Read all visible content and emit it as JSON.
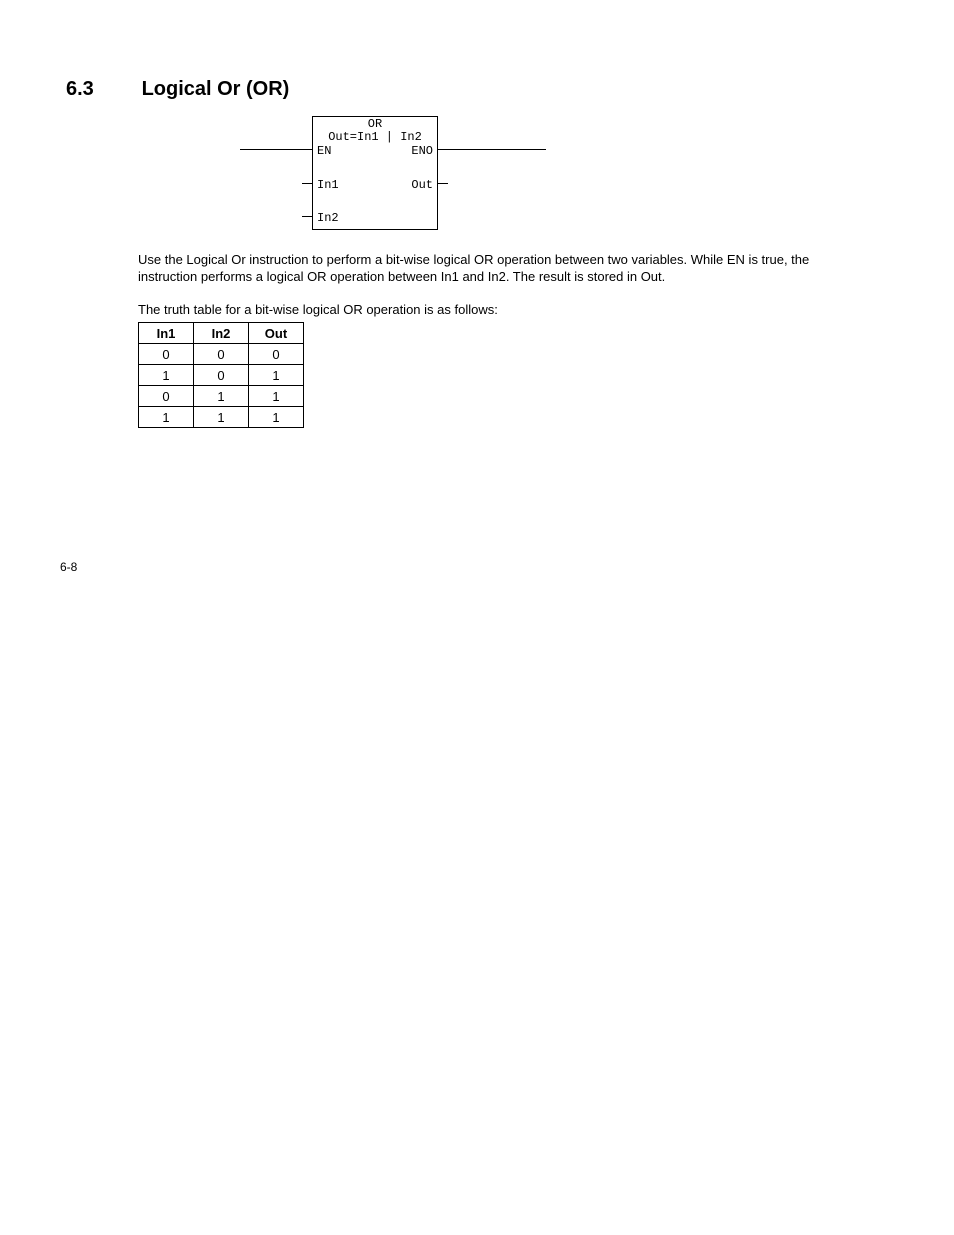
{
  "heading": {
    "number": "6.3",
    "title": "Logical Or (OR)"
  },
  "diagram": {
    "name": "OR",
    "formula": "Out=In1 | In2",
    "ports": {
      "en": "EN",
      "eno": "ENO",
      "in1": "In1",
      "in2": "In2",
      "out": "Out"
    }
  },
  "paragraphs": {
    "desc": "Use the Logical Or instruction to perform a bit-wise logical OR operation between two variables. While EN is true, the instruction performs a logical OR operation between In1 and In2. The result is stored in Out.",
    "truth_intro": "The truth table for a bit-wise logical OR operation is as follows:"
  },
  "truth_table": {
    "headers": [
      "In1",
      "In2",
      "Out"
    ],
    "rows": [
      [
        "0",
        "0",
        "0"
      ],
      [
        "1",
        "0",
        "1"
      ],
      [
        "0",
        "1",
        "1"
      ],
      [
        "1",
        "1",
        "1"
      ]
    ]
  },
  "page_number": "6-8"
}
